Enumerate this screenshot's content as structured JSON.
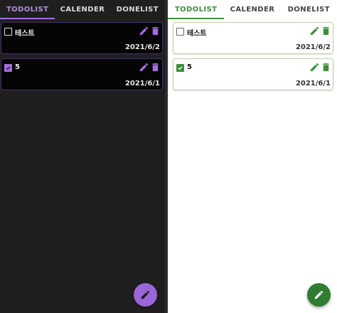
{
  "tabs": [
    {
      "label": "TODOLIST",
      "active": true
    },
    {
      "label": "CALENDER",
      "active": false
    },
    {
      "label": "DONELIST",
      "active": false
    }
  ],
  "todos": [
    {
      "title": "테스트",
      "date": "2021/6/2",
      "checked": false
    },
    {
      "title": "5",
      "date": "2021/6/1",
      "checked": true
    }
  ],
  "themes": {
    "dark": {
      "accent": "#a56de3",
      "background": "#1f1f1f",
      "card": "#050505"
    },
    "light": {
      "accent": "#3d8f3d",
      "background": "#ffffff",
      "card": "#ffffff"
    }
  },
  "icons": {
    "edit": "pencil-icon",
    "delete": "trash-icon",
    "checkbox": "checkbox-icon",
    "fab": "pencil-icon"
  }
}
